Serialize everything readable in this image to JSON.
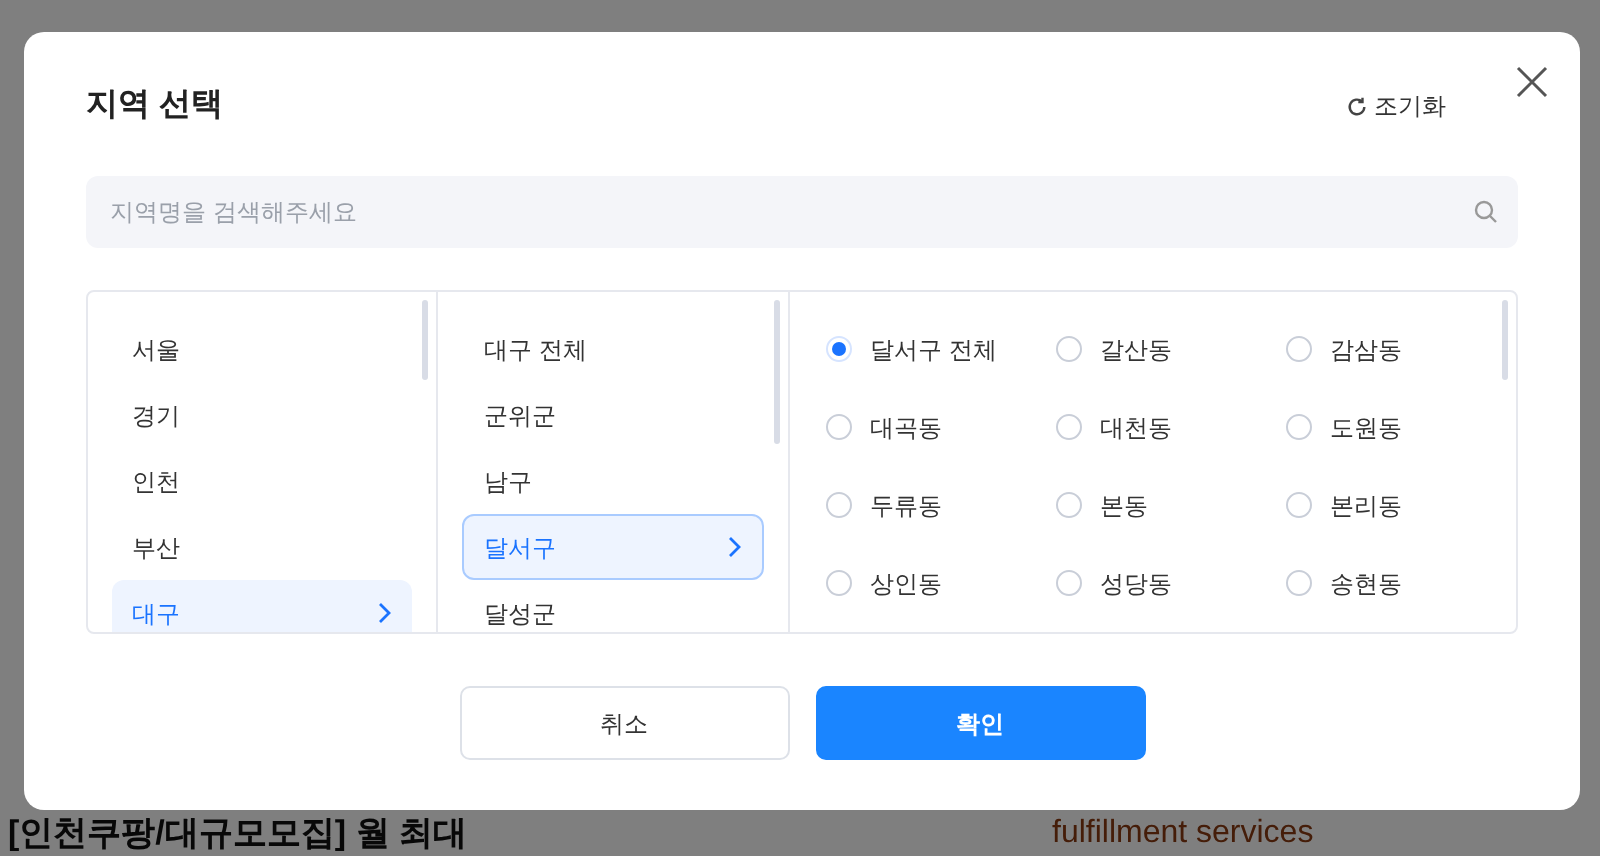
{
  "background": {
    "headline": "[인천쿠팡/대규모모집] 월 최대",
    "tagline": "fulfillment services"
  },
  "dialog": {
    "title": "지역 선택",
    "reset_label": "조기화",
    "search": {
      "placeholder": "지역명을 검색해주세요"
    },
    "regions": [
      {
        "label": "서울",
        "selected": false
      },
      {
        "label": "경기",
        "selected": false
      },
      {
        "label": "인천",
        "selected": false
      },
      {
        "label": "부산",
        "selected": false
      },
      {
        "label": "대구",
        "selected": true
      }
    ],
    "districts": [
      {
        "label": "대구 전체",
        "selected": false
      },
      {
        "label": "군위군",
        "selected": false
      },
      {
        "label": "남구",
        "selected": false
      },
      {
        "label": "달서구",
        "selected": true
      },
      {
        "label": "달성군",
        "selected": false
      }
    ],
    "neighborhoods": [
      {
        "label": "달서구 전체",
        "selected": true
      },
      {
        "label": "갈산동",
        "selected": false
      },
      {
        "label": "감삼동",
        "selected": false
      },
      {
        "label": "대곡동",
        "selected": false
      },
      {
        "label": "대천동",
        "selected": false
      },
      {
        "label": "도원동",
        "selected": false
      },
      {
        "label": "두류동",
        "selected": false
      },
      {
        "label": "본동",
        "selected": false
      },
      {
        "label": "본리동",
        "selected": false
      },
      {
        "label": "상인동",
        "selected": false
      },
      {
        "label": "성당동",
        "selected": false
      },
      {
        "label": "송현동",
        "selected": false
      }
    ],
    "buttons": [
      {
        "label": "취소",
        "kind": "secondary"
      },
      {
        "label": "확인",
        "kind": "primary"
      }
    ]
  }
}
